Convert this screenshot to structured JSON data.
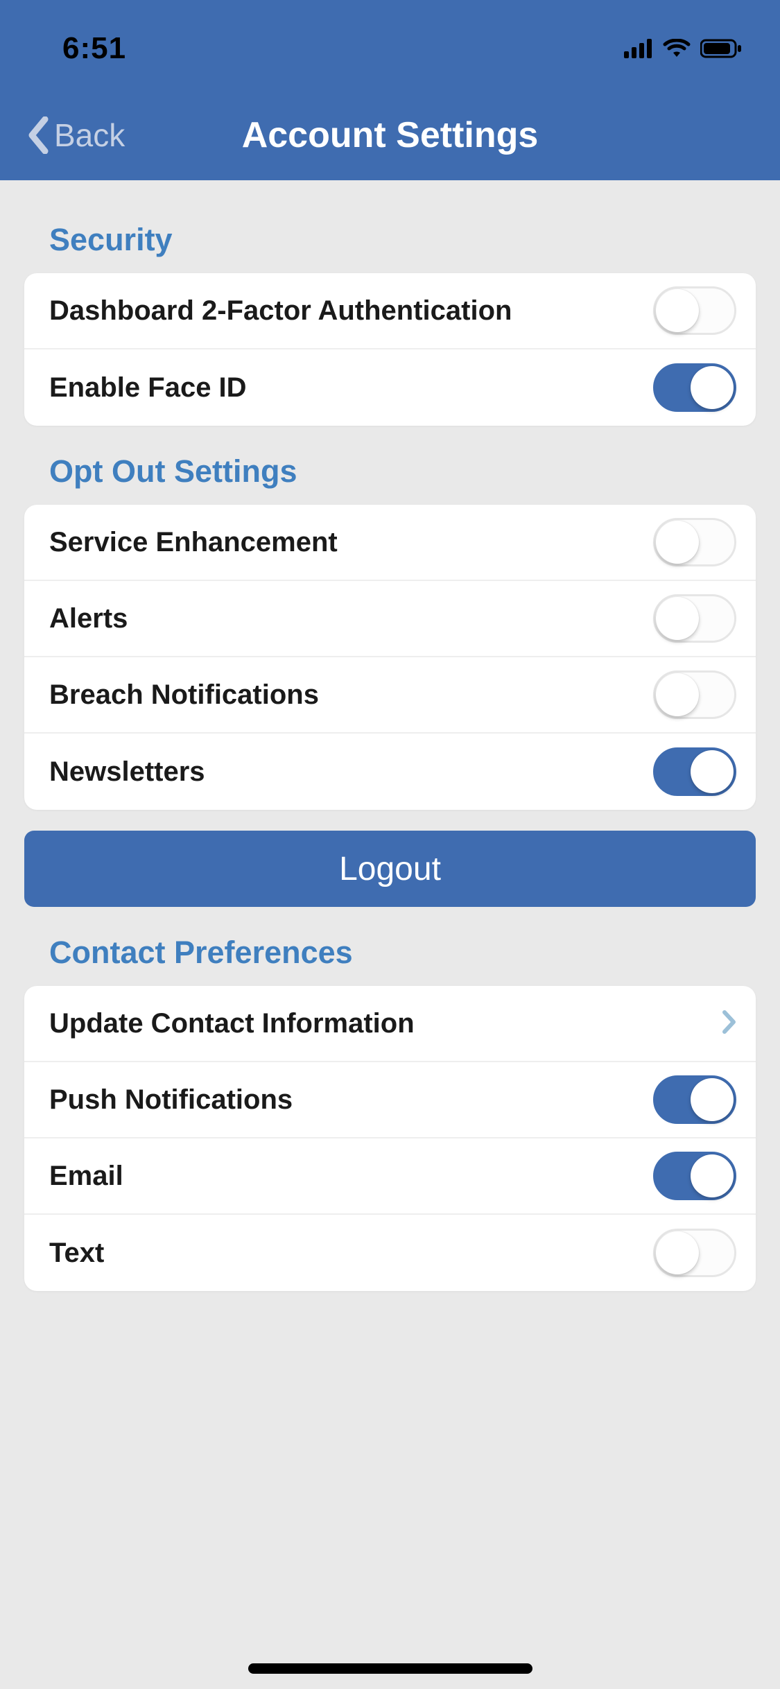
{
  "status": {
    "time": "6:51"
  },
  "nav": {
    "back_label": "Back",
    "title": "Account Settings"
  },
  "sections": {
    "security": {
      "title": "Security",
      "items": [
        {
          "label": "Dashboard 2-Factor Authentication",
          "on": false
        },
        {
          "label": "Enable Face ID",
          "on": true
        }
      ]
    },
    "optout": {
      "title": "Opt Out Settings",
      "items": [
        {
          "label": "Service Enhancement",
          "on": false
        },
        {
          "label": "Alerts",
          "on": false
        },
        {
          "label": "Breach Notifications",
          "on": false
        },
        {
          "label": "Newsletters",
          "on": true
        }
      ]
    },
    "contact": {
      "title": "Contact Preferences",
      "link": {
        "label": "Update Contact Information"
      },
      "items": [
        {
          "label": "Push Notifications",
          "on": true
        },
        {
          "label": "Email",
          "on": true
        },
        {
          "label": "Text",
          "on": false
        }
      ]
    }
  },
  "logout_label": "Logout"
}
